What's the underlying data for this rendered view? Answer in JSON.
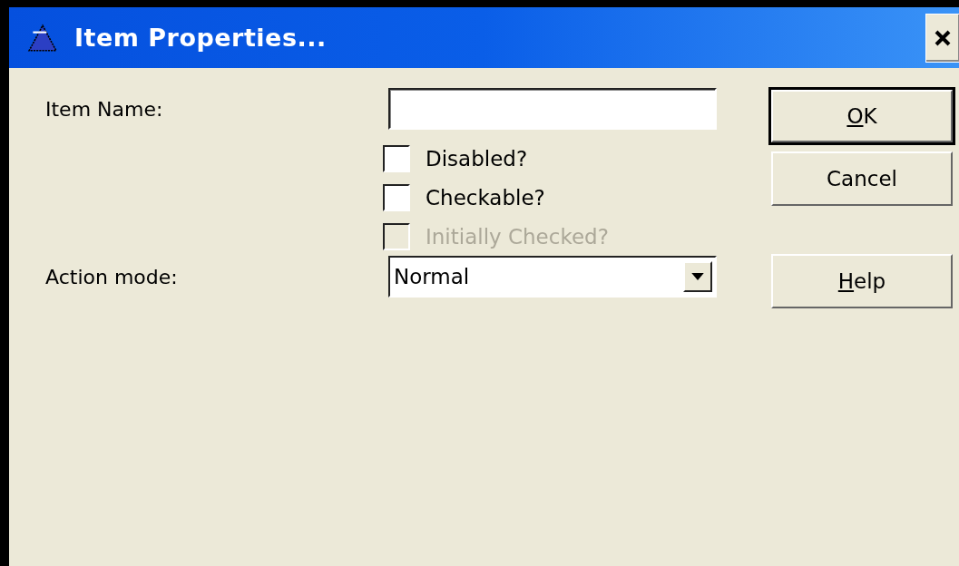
{
  "window": {
    "title": "Item Properties..."
  },
  "item_name": {
    "label": "Item Name:"
  },
  "options": [
    {
      "label": "Disabled?",
      "checked": false,
      "disabled": false
    },
    {
      "label": "Checkable?",
      "checked": false,
      "disabled": false
    },
    {
      "label": "Initially Checked?",
      "checked": false,
      "disabled": true
    }
  ],
  "action_mode": {
    "label": "Action mode:",
    "value": "Normal"
  },
  "buttons": [
    {
      "label": "OK",
      "default": true,
      "underline_first": true
    },
    {
      "label": "Cancel",
      "default": false,
      "underline_first": false
    },
    {
      "label": "Help",
      "default": false,
      "underline_first": true
    }
  ]
}
